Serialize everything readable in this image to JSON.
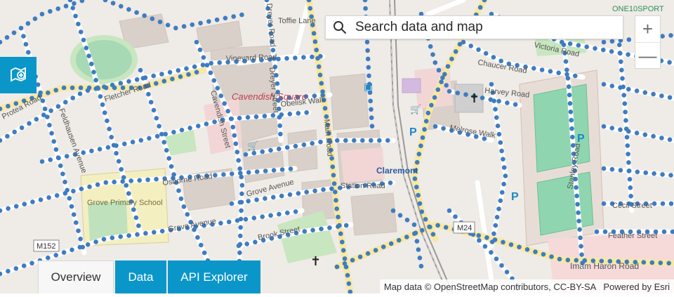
{
  "search": {
    "placeholder": "Search data and map"
  },
  "zoom": {
    "in_label": "+",
    "out_label": "—"
  },
  "tabs": [
    {
      "label": "Overview",
      "active": true
    },
    {
      "label": "Data",
      "active": false
    },
    {
      "label": "API Explorer",
      "active": false
    }
  ],
  "attribution": {
    "map_data": "Map data © OpenStreetMap contributors, CC-BY-SA",
    "powered_by": "Powered by Esri"
  },
  "map": {
    "labels": {
      "toffie_lane": "Toffie Lane",
      "vineyard_road": "Vineyard Road",
      "cavendish_square": "Cavendish Square",
      "obelisk_walk": "Obelisk Walk",
      "cavendish_street": "Cavendish Street",
      "dreyer_street": "Dreyer Street",
      "grove_primary": "Grove Primary School",
      "grove_avenue": "Grove Avenue",
      "osborne_road": "Osborne Road",
      "claremont": "Claremont",
      "station_road": "Station Road",
      "main_road": "Main Road",
      "m24": "M24",
      "m152": "M152",
      "cecil_street": "Cecil Street",
      "feather_street": "Feather Street",
      "imam_haron_road": "Imam Haron Road",
      "one10sport": "ONE10SPORT",
      "protea_road": "Protea Road",
      "feldhausen_avenue": "Feldhausen Avenue",
      "fletcher_road": "Fletcher Road",
      "stanley_road": "Stanley Road",
      "brook_street": "Brook Street",
      "chaucer_road": "Chaucer Road",
      "primrose_walk": "Melrose Walk",
      "harvey_road": "Harvey Road",
      "victoria_road": "Victoria Road",
      "dreyer_road": "Dreyer Road"
    },
    "colors": {
      "background": "#efebe6",
      "building": "#d9d0c9",
      "road": "#ffffff",
      "major_road": "#f7e8a3",
      "park": "#c8e6bf",
      "pitch": "#8fd6b0",
      "rail": "#9a9a9a",
      "dot": "#3f7cc0",
      "accent": "#0b96c9",
      "poi": "#1e88c7"
    }
  }
}
